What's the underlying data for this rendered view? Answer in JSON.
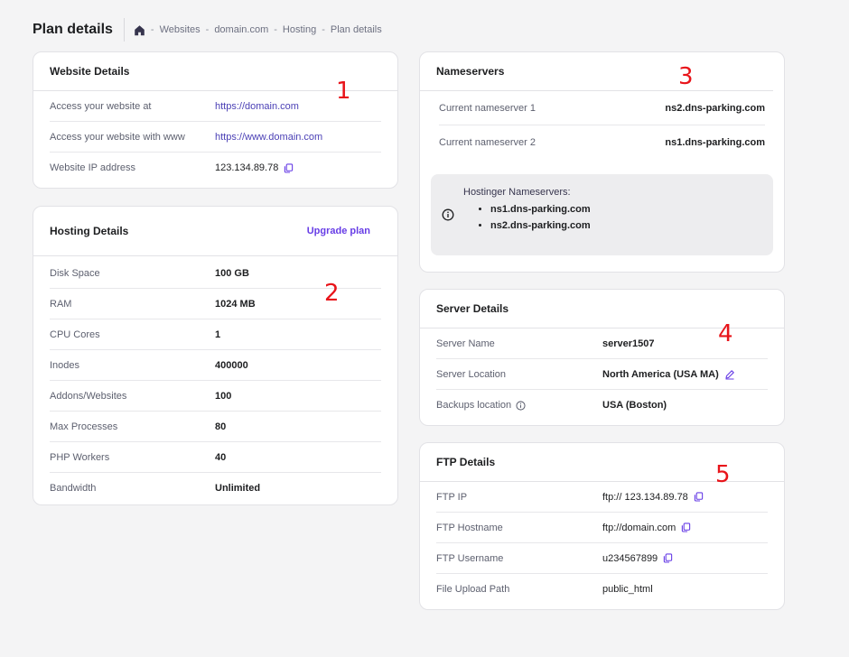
{
  "page_title": "Plan details",
  "breadcrumb": [
    "Websites",
    "domain.com",
    "Hosting",
    "Plan details"
  ],
  "website_details": {
    "title": "Website Details",
    "rows": [
      {
        "label": "Access your website at",
        "value": "https://domain.com"
      },
      {
        "label": "Access your website with www",
        "value": "https://www.domain.com"
      },
      {
        "label": "Website IP address",
        "value": "123.134.89.78"
      }
    ]
  },
  "hosting_details": {
    "title": "Hosting Details",
    "upgrade_label": "Upgrade plan",
    "rows": [
      {
        "label": "Disk Space",
        "value": "100 GB"
      },
      {
        "label": "RAM",
        "value": "1024 MB"
      },
      {
        "label": "CPU Cores",
        "value": "1"
      },
      {
        "label": "Inodes",
        "value": "400000"
      },
      {
        "label": "Addons/Websites",
        "value": "100"
      },
      {
        "label": "Max Processes",
        "value": "80"
      },
      {
        "label": "PHP Workers",
        "value": "40"
      },
      {
        "label": "Bandwidth",
        "value": "Unlimited"
      }
    ]
  },
  "nameservers": {
    "title": "Nameservers",
    "rows": [
      {
        "label": "Current nameserver 1",
        "value": "ns2.dns-parking.com"
      },
      {
        "label": "Current nameserver 2",
        "value": "ns1.dns-parking.com"
      }
    ],
    "info_title": "Hostinger Nameservers:",
    "info_items": [
      "ns1.dns-parking.com",
      "ns2.dns-parking.com"
    ]
  },
  "server_details": {
    "title": "Server Details",
    "rows": [
      {
        "label": "Server Name",
        "value": "server1507"
      },
      {
        "label": "Server Location",
        "value": "North America (USA MA)"
      },
      {
        "label": "Backups location",
        "value": "USA (Boston)"
      }
    ]
  },
  "ftp_details": {
    "title": "FTP Details",
    "rows": [
      {
        "label": "FTP IP",
        "value": "ftp:// 123.134.89.78"
      },
      {
        "label": "FTP Hostname",
        "value": "ftp://domain.com"
      },
      {
        "label": "FTP Username",
        "value": "u234567899"
      },
      {
        "label": "File Upload Path",
        "value": "public_html"
      }
    ]
  },
  "annotations": [
    "1",
    "2",
    "3",
    "4",
    "5"
  ],
  "colors": {
    "accent": "#673de6",
    "annotation": "#e8141a",
    "background": "#f4f4f5"
  },
  "icons": [
    "home-icon",
    "copy-icon",
    "info-icon",
    "edit-icon"
  ]
}
